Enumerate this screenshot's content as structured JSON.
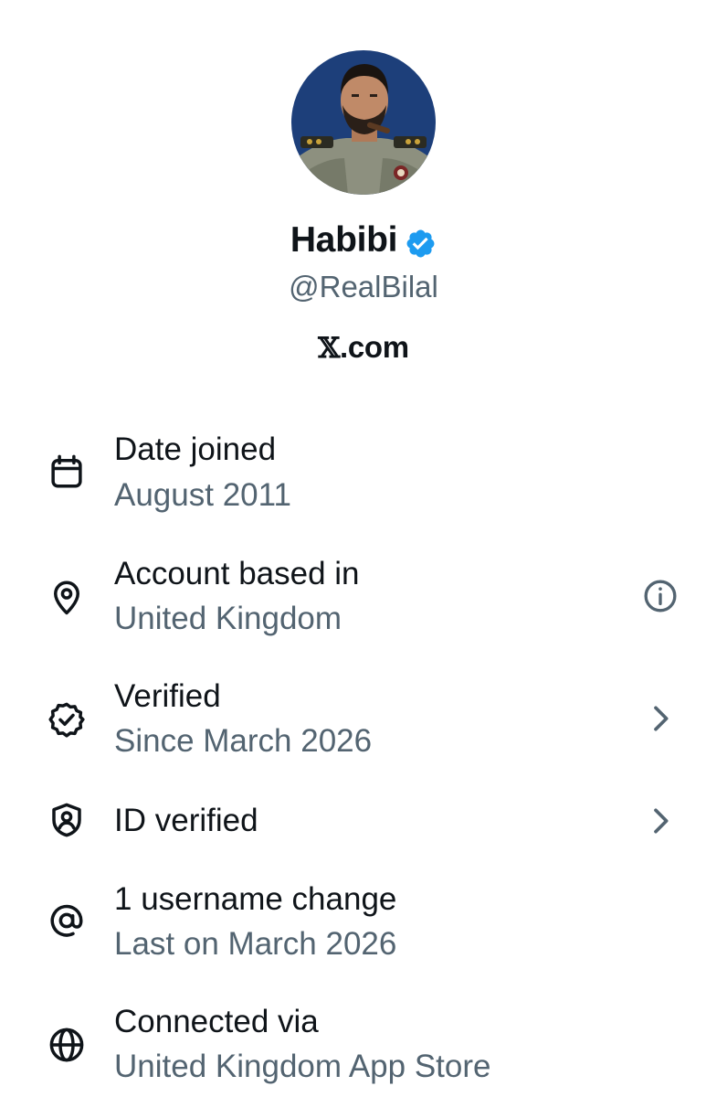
{
  "profile": {
    "display_name": "Habibi",
    "handle": "@RealBilal",
    "website_logo": "𝕏",
    "website_suffix": ".com",
    "verified_badge": "blue-checkmark-badge",
    "badge_color": "#1d9bf0"
  },
  "about": {
    "items": [
      {
        "icon": "calendar-icon",
        "title": "Date joined",
        "subtitle": "August 2011"
      },
      {
        "icon": "location-pin-icon",
        "title": "Account based in",
        "subtitle": "United Kingdom",
        "right_icon": "info-icon"
      },
      {
        "icon": "verified-badge-icon",
        "title": "Verified",
        "subtitle": "Since March 2026",
        "right_icon": "chevron-right-icon"
      },
      {
        "icon": "id-shield-icon",
        "title": "ID verified",
        "right_icon": "chevron-right-icon"
      },
      {
        "icon": "at-sign-icon",
        "title": "1 username change",
        "subtitle": "Last on March 2026"
      },
      {
        "icon": "globe-icon",
        "title": "Connected via",
        "subtitle": "United Kingdom App Store"
      }
    ]
  },
  "colors": {
    "text_primary": "#0f1419",
    "text_secondary": "#536471",
    "accent": "#1d9bf0",
    "background": "#ffffff"
  }
}
